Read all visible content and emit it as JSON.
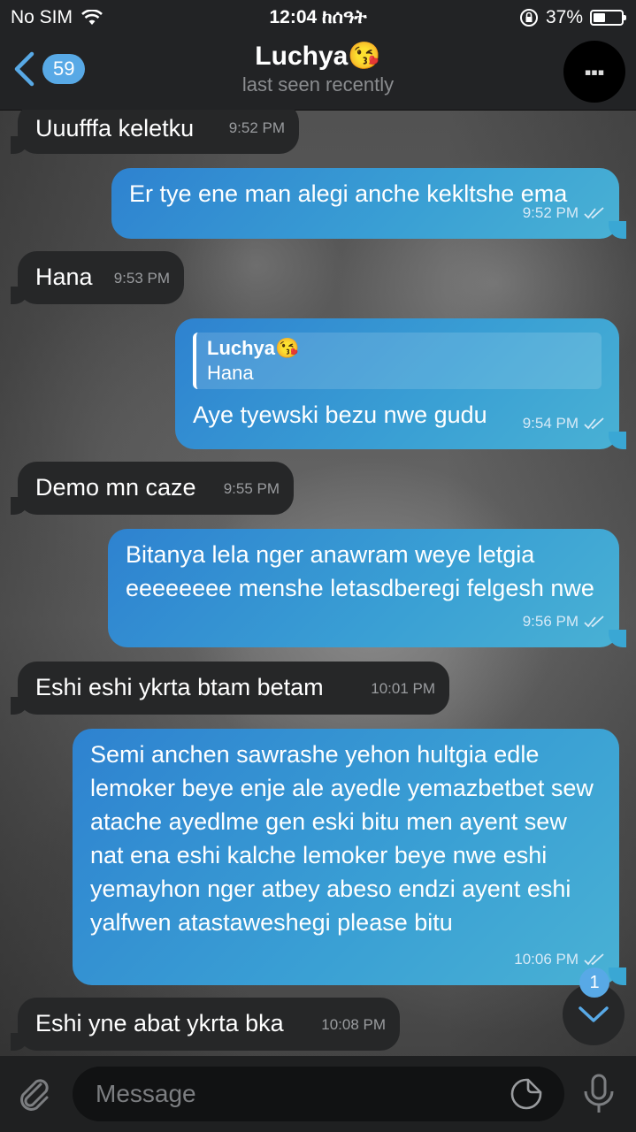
{
  "status_bar": {
    "carrier": "No SIM",
    "time": "12:04 ከሰዓት",
    "battery": "37%",
    "battery_level": 0.37
  },
  "header": {
    "back_badge": "59",
    "title": "Luchya😘",
    "subtitle": "last seen recently"
  },
  "messages": [
    {
      "dir": "in",
      "text": "Uuufffa keletku",
      "time": "9:52 PM"
    },
    {
      "dir": "out",
      "text": "Er tye ene man alegi anche kekltshe ema",
      "time": "9:52 PM"
    },
    {
      "dir": "in",
      "text": "Hana",
      "time": "9:53 PM"
    },
    {
      "dir": "out",
      "reply_name": "Luchya😘",
      "reply_text": "Hana",
      "text": "Aye tyewski bezu nwe gudu",
      "time": "9:54 PM"
    },
    {
      "dir": "in",
      "text": "Demo mn caze",
      "time": "9:55 PM"
    },
    {
      "dir": "out",
      "text": "Bitanya lela nger anawram weye letgia eeeeeeee menshe letasdberegi felgesh nwe",
      "time": "9:56 PM"
    },
    {
      "dir": "in",
      "text": "Eshi eshi ykrta  btam betam",
      "time": "10:01 PM"
    },
    {
      "dir": "out",
      "text": "Semi anchen sawrashe yehon hultgia edle lemoker beye enje ale ayedle yemazbetbet sew atache ayedlme gen eski bitu men ayent sew nat ena eshi kalche lemoker beye nwe eshi yemayhon nger atbey abeso endzi ayent eshi yalfwen atastaweshegi please bitu",
      "time": "10:06 PM"
    },
    {
      "dir": "in",
      "text": "Eshi yne abat ykrta bka",
      "time": "10:08 PM"
    }
  ],
  "scroll_unread": "1",
  "input": {
    "placeholder": "Message"
  },
  "icons": {
    "wifi": "wifi-icon",
    "lock_rotation": "rotation-lock-icon",
    "back": "chevron-left-icon",
    "attach": "paperclip-icon",
    "sticker": "sticker-icon",
    "mic": "microphone-icon",
    "scroll_down": "chevron-down-icon",
    "read": "double-check-icon"
  },
  "colors": {
    "accent": "#58a9e6",
    "incoming_bubble": "#262728",
    "outgoing_bubble": "#3aa0d4"
  }
}
